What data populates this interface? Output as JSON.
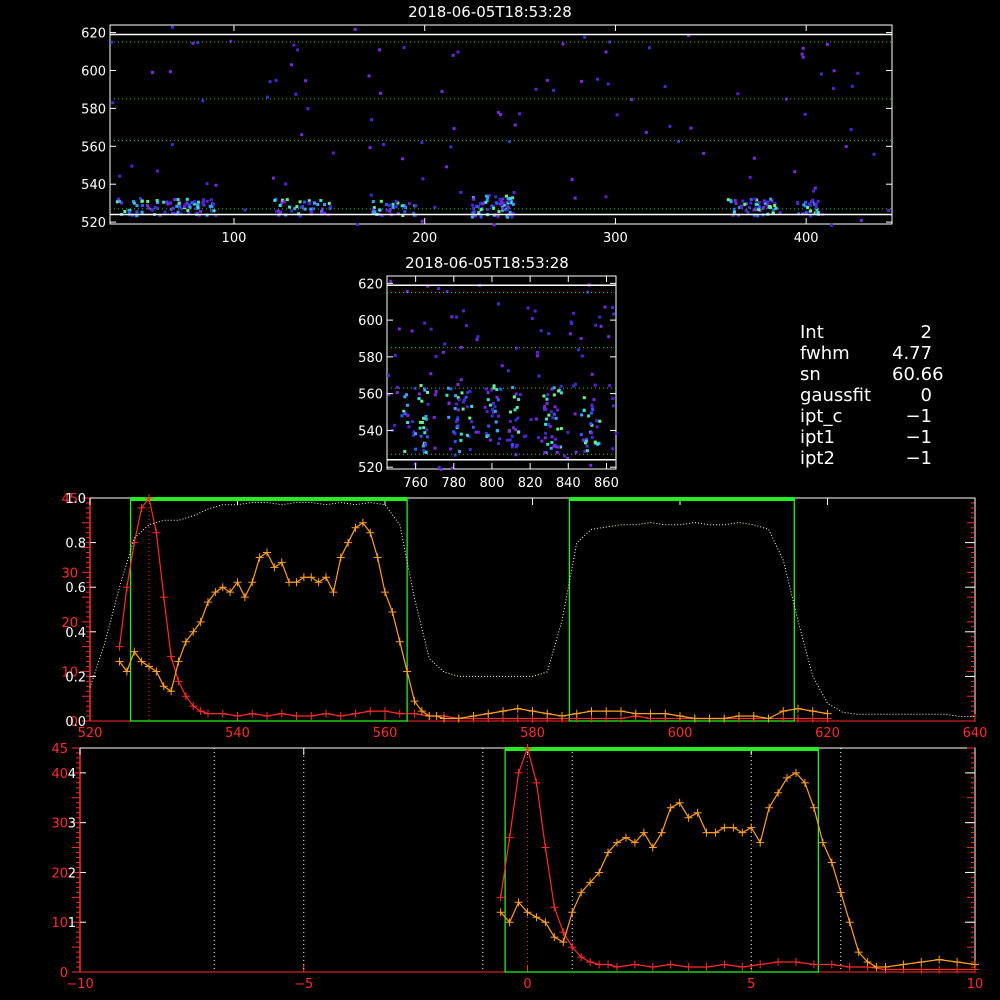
{
  "timestamp": "2018-06-05T18:53:28",
  "colors": {
    "background": "#000000",
    "axis": "#ffffff",
    "red_series": "#ff2a2a",
    "orange_series": "#ffa020",
    "green_window": "#22ee22",
    "dotted_guide": "#ffffcc"
  },
  "info": [
    {
      "key": "Int",
      "value": "2"
    },
    {
      "key": "fwhm",
      "value": "4.77"
    },
    {
      "key": "sn",
      "value": "60.66"
    },
    {
      "key": "gaussfit",
      "value": "0"
    },
    {
      "key": "ipt_c",
      "value": "−1"
    },
    {
      "key": "ipt1",
      "value": "−1"
    },
    {
      "key": "ipt2",
      "value": "−1"
    }
  ],
  "chart_data": [
    {
      "type": "heatmap",
      "title": "2018-06-05T18:53:28",
      "xlim": [
        35,
        445
      ],
      "ylim": [
        519,
        624
      ],
      "xticks": [
        100,
        200,
        300,
        400
      ],
      "yticks": [
        520,
        540,
        560,
        580,
        600,
        620
      ],
      "hlines_dotted": [
        615,
        585,
        563,
        527
      ],
      "hlines_solid": [
        524,
        619
      ],
      "note": "sparse blue/violet/cyan speckle, dense bands near 525-532 at x≈40-90, 120-150, 175-195, 225-245, 360-385, 395-405"
    },
    {
      "type": "heatmap",
      "title": "2018-06-05T18:53:28",
      "xlim": [
        745,
        865
      ],
      "ylim": [
        519,
        624
      ],
      "xticks": [
        760,
        780,
        800,
        820,
        840,
        860
      ],
      "yticks": [
        520,
        540,
        560,
        580,
        600,
        620
      ],
      "hlines_dotted": [
        615,
        585,
        563,
        527
      ],
      "hlines_solid": [
        524,
        619
      ],
      "note": "speckle columns concentrated between y 530-565 near x≈760, 780, 800, 810, 830, 850"
    },
    {
      "type": "line",
      "xlim": [
        520,
        640
      ],
      "xticks": [
        520,
        540,
        560,
        580,
        600,
        620,
        640
      ],
      "left_axis_red": {
        "range": [
          0,
          45
        ],
        "ticks": [
          0,
          10,
          20,
          30,
          45
        ],
        "tick_labels": [
          "0",
          "10",
          "20",
          "30",
          "45"
        ]
      },
      "left_axis_white": {
        "range": [
          0,
          1
        ],
        "ticks": [
          0,
          0.2,
          0.4,
          0.6,
          0.8,
          1.0
        ],
        "tick_labels": [
          "0.0",
          "0.2",
          "0.4",
          "0.6",
          "0.8",
          "1.0"
        ]
      },
      "green_windows": [
        [
          525.5,
          563.0
        ],
        [
          585.0,
          615.5
        ]
      ],
      "green_top_bars": [
        [
          525.5,
          563.0
        ],
        [
          585.0,
          615.5
        ]
      ],
      "red_marker_x": 528,
      "series": [
        {
          "color": "red",
          "x": [
            524,
            525,
            526,
            527,
            528,
            529,
            530,
            531,
            532,
            533,
            534,
            535,
            536,
            538,
            540,
            542,
            544,
            546,
            548,
            550,
            552,
            554,
            556,
            558,
            560,
            562,
            564,
            566,
            568,
            570,
            572,
            574,
            576,
            578,
            580,
            582,
            584,
            586,
            588,
            590,
            592,
            594,
            596,
            598,
            600,
            602,
            604,
            606,
            608,
            610,
            612,
            614,
            616,
            618,
            620
          ],
          "y": [
            15,
            27,
            36,
            43,
            45,
            38,
            25,
            13,
            8,
            5,
            3,
            2,
            1.5,
            1.5,
            1,
            1.5,
            1,
            1.5,
            1,
            1,
            1.5,
            1,
            1.5,
            2,
            2,
            1.5,
            1.5,
            1,
            1,
            0.5,
            0.5,
            0.5,
            0.5,
            0.5,
            0.5,
            0.5,
            0.5,
            0.5,
            0.5,
            0.5,
            0.5,
            1,
            0.5,
            0.5,
            0.5,
            0.5,
            0.5,
            0.5,
            0.5,
            0.5,
            0.5,
            0.5,
            0.5,
            0.5,
            0.5
          ]
        },
        {
          "color": "orange",
          "x": [
            524,
            525,
            526,
            527,
            528,
            529,
            530,
            531,
            532,
            533,
            534,
            535,
            536,
            537,
            538,
            539,
            540,
            541,
            542,
            543,
            544,
            545,
            546,
            547,
            548,
            549,
            550,
            551,
            552,
            553,
            554,
            555,
            556,
            557,
            558,
            559,
            560,
            561,
            562,
            563,
            564,
            565,
            566,
            567,
            568,
            570,
            572,
            574,
            576,
            578,
            580,
            582,
            584,
            586,
            588,
            590,
            592,
            594,
            596,
            598,
            600,
            602,
            604,
            606,
            608,
            610,
            612,
            614,
            616,
            618,
            620
          ],
          "y": [
            12,
            10,
            14,
            12,
            11,
            10,
            7,
            6,
            12,
            16,
            18,
            20,
            24,
            26,
            27,
            26,
            28,
            25,
            28,
            33,
            34,
            31,
            32,
            28,
            28,
            29,
            29,
            28,
            29,
            26,
            33,
            36,
            39,
            40,
            38,
            33,
            26,
            22,
            16,
            10,
            4,
            2,
            1,
            1,
            0.5,
            0.5,
            1,
            1.5,
            2,
            2.5,
            2,
            1.5,
            1,
            1.5,
            2,
            2,
            2,
            1.5,
            1.5,
            1.5,
            1,
            0.5,
            0.5,
            0.5,
            1,
            1,
            0.5,
            2,
            2.5,
            2,
            1.5
          ]
        },
        {
          "color": "white",
          "style": "dotted",
          "x": [
            520,
            522,
            524,
            526,
            528,
            530,
            532,
            534,
            536,
            538,
            540,
            542,
            544,
            546,
            548,
            550,
            552,
            554,
            556,
            558,
            560,
            562,
            564,
            566,
            568,
            570,
            572,
            574,
            576,
            578,
            580,
            582,
            584,
            586,
            588,
            590,
            592,
            594,
            596,
            598,
            600,
            602,
            604,
            606,
            608,
            610,
            612,
            614,
            616,
            618,
            620,
            622,
            624,
            626,
            628,
            630,
            632,
            634,
            636,
            638,
            640
          ],
          "y": [
            0.15,
            0.35,
            0.6,
            0.82,
            0.88,
            0.9,
            0.9,
            0.92,
            0.95,
            0.97,
            0.97,
            0.98,
            0.98,
            0.97,
            0.98,
            0.98,
            0.97,
            0.98,
            0.97,
            0.98,
            0.97,
            0.88,
            0.55,
            0.28,
            0.22,
            0.2,
            0.2,
            0.2,
            0.2,
            0.2,
            0.2,
            0.22,
            0.45,
            0.8,
            0.86,
            0.87,
            0.88,
            0.88,
            0.89,
            0.88,
            0.88,
            0.89,
            0.88,
            0.88,
            0.89,
            0.88,
            0.86,
            0.72,
            0.45,
            0.2,
            0.08,
            0.04,
            0.03,
            0.03,
            0.03,
            0.03,
            0.03,
            0.03,
            0.03,
            0.02,
            0.02
          ]
        }
      ]
    },
    {
      "type": "line",
      "xlim": [
        -10,
        10
      ],
      "xticks": [
        -10,
        -5,
        0,
        5,
        10
      ],
      "left_axis_red": {
        "range": [
          0,
          45
        ],
        "ticks": [
          0,
          10,
          20,
          30,
          40,
          45
        ],
        "tick_labels": [
          "0",
          "10",
          "20",
          "30",
          "40",
          "45"
        ]
      },
      "left_axis_white": {
        "range": [
          0,
          4.5
        ],
        "ticks": [
          1,
          2,
          3,
          4
        ],
        "tick_labels": [
          "1",
          "2",
          "3",
          "4"
        ]
      },
      "green_windows": [
        [
          -0.5,
          6.5
        ]
      ],
      "green_top_bars": [
        [
          -0.5,
          6.5
        ]
      ],
      "vertical_dotted": [
        -7,
        -5,
        -1,
        1,
        5,
        7
      ],
      "red_marker_x": 0,
      "series": [
        {
          "color": "red",
          "x": [
            -0.6,
            -0.4,
            -0.2,
            0,
            0.2,
            0.4,
            0.6,
            0.8,
            1.0,
            1.2,
            1.4,
            1.6,
            1.8,
            2.0,
            2.4,
            2.8,
            3.2,
            3.6,
            4.0,
            4.4,
            4.8,
            5.2,
            5.6,
            6.0,
            6.4,
            6.8,
            7.2,
            7.6,
            8.0,
            8.4,
            8.8,
            9.2,
            9.6,
            10
          ],
          "y": [
            15,
            27,
            40,
            45,
            38,
            25,
            13,
            8,
            5,
            3,
            2,
            1.5,
            1.5,
            1,
            1.5,
            1,
            1.5,
            1,
            1,
            1.5,
            1,
            1.5,
            2,
            2,
            1.5,
            1.5,
            1,
            1,
            0.5,
            0.5,
            0.5,
            0.5,
            0.5,
            0.5
          ]
        },
        {
          "color": "orange",
          "x": [
            -0.6,
            -0.4,
            -0.2,
            0,
            0.2,
            0.4,
            0.6,
            0.8,
            1.0,
            1.2,
            1.4,
            1.6,
            1.8,
            2.0,
            2.2,
            2.4,
            2.6,
            2.8,
            3.0,
            3.2,
            3.4,
            3.6,
            3.8,
            4.0,
            4.2,
            4.4,
            4.6,
            4.8,
            5.0,
            5.2,
            5.4,
            5.6,
            5.8,
            6.0,
            6.2,
            6.4,
            6.6,
            6.8,
            7.0,
            7.2,
            7.4,
            7.6,
            7.8,
            8.0,
            8.4,
            8.8,
            9.2,
            9.6,
            10
          ],
          "y": [
            12,
            10,
            14,
            12,
            11,
            10,
            7,
            6,
            12,
            16,
            18,
            20,
            24,
            26,
            27,
            26,
            28,
            25,
            28,
            33,
            34,
            31,
            32,
            28,
            28,
            29,
            29,
            28,
            29,
            26,
            33,
            36,
            39,
            40,
            38,
            33,
            26,
            22,
            16,
            10,
            4,
            2,
            1,
            1,
            1.5,
            2,
            2.5,
            2,
            1.5
          ]
        }
      ]
    }
  ]
}
